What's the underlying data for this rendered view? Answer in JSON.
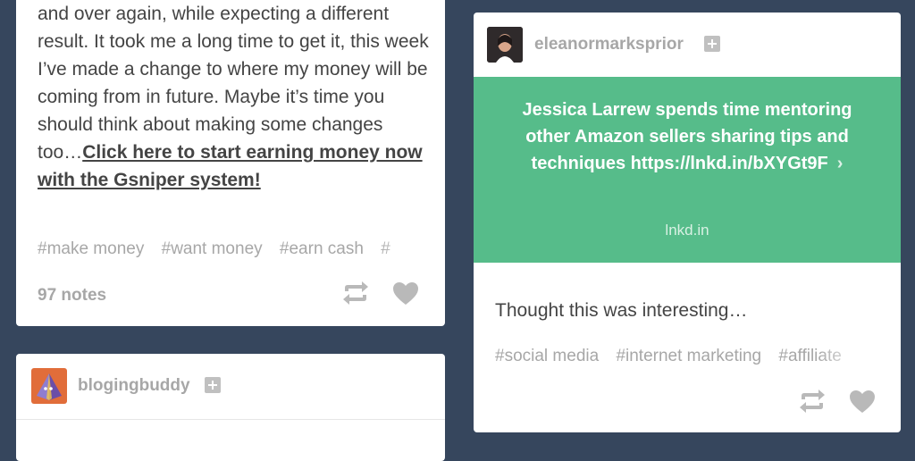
{
  "left_post": {
    "body_text": "and over again, while expecting a different result. It took me a long time to get it, this week I’ve made a change to where my money will be coming from in future. Maybe it’s time you should think about making some changes too…",
    "link_text": "Click here to start earning money now with the Gsniper system! ",
    "tags": [
      "#make money",
      "#want money",
      "#earn cash",
      "#"
    ],
    "notes": "97 notes",
    "reblog_icon": "reblog-icon",
    "like_icon": "heart-icon"
  },
  "left_post_2": {
    "username": "blogingbuddy",
    "avatar_icon": "pyramid-avatar",
    "follow_icon": "plus-icon"
  },
  "right_post": {
    "username": "eleanormarksprior",
    "follow_icon": "plus-icon",
    "link_card": {
      "title": "Jessica Larrew spends time mentoring other Amazon sellers sharing tips and techniques https://lnkd.in/bXYGt9F",
      "chevron": "›",
      "host": "lnkd.in"
    },
    "caption": "Thought this was interesting…",
    "tags": [
      "#social media",
      "#internet marketing",
      "#affiliate"
    ],
    "reblog_icon": "reblog-icon",
    "like_icon": "heart-icon"
  },
  "colors": {
    "background": "#36465d",
    "card": "#ffffff",
    "link_card_green": "#56bc8a",
    "muted_text": "#a7a7a7",
    "body_text": "#444444"
  }
}
